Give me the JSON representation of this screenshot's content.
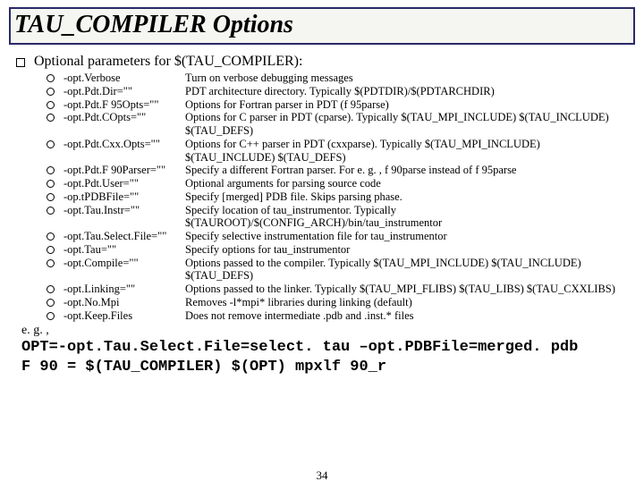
{
  "title": "TAU_COMPILER Options",
  "intro": "Optional parameters for $(TAU_COMPILER):",
  "options": [
    {
      "name": "-opt.Verbose",
      "desc": "Turn on verbose debugging messages"
    },
    {
      "name": "-opt.Pdt.Dir=\"\"",
      "desc": "PDT architecture directory. Typically $(PDTDIR)/$(PDTARCHDIR)"
    },
    {
      "name": "-opt.Pdt.F 95Opts=\"\"",
      "desc": "Options for Fortran parser in PDT (f 95parse)"
    },
    {
      "name": "-opt.Pdt.COpts=\"\"",
      "desc": "Options for C parser in PDT (cparse). Typically $(TAU_MPI_INCLUDE) $(TAU_INCLUDE) $(TAU_DEFS)"
    },
    {
      "name": "-opt.Pdt.Cxx.Opts=\"\"",
      "desc": "Options for C++ parser in PDT (cxxparse). Typically $(TAU_MPI_INCLUDE) $(TAU_INCLUDE) $(TAU_DEFS)"
    },
    {
      "name": "-opt.Pdt.F 90Parser=\"\"",
      "desc": "Specify a different Fortran parser. For e. g. , f 90parse instead of f 95parse"
    },
    {
      "name": "-opt.Pdt.User=\"\"",
      "desc": "Optional arguments for parsing source code"
    },
    {
      "name": "-op.tPDBFile=\"\"",
      "desc": "Specify [merged] PDB file. Skips parsing phase."
    },
    {
      "name": "-opt.Tau.Instr=\"\"",
      "desc": "Specify location of tau_instrumentor. Typically $(TAUROOT)/$(CONFIG_ARCH)/bin/tau_instrumentor"
    },
    {
      "name": "-opt.Tau.Select.File=\"\"",
      "desc": "Specify selective instrumentation file for tau_instrumentor"
    },
    {
      "name": "-opt.Tau=\"\"",
      "desc": "Specify options for tau_instrumentor"
    },
    {
      "name": "-opt.Compile=\"\"",
      "desc": "Options passed to the compiler. Typically $(TAU_MPI_INCLUDE) $(TAU_INCLUDE) $(TAU_DEFS)"
    },
    {
      "name": "-opt.Linking=\"\"",
      "desc": "Options passed to the linker. Typically $(TAU_MPI_FLIBS) $(TAU_LIBS) $(TAU_CXXLIBS)"
    },
    {
      "name": "-opt.No.Mpi",
      "desc": "Removes -l*mpi* libraries during linking (default)"
    },
    {
      "name": "-opt.Keep.Files",
      "desc": "Does not remove intermediate .pdb and .inst.* files"
    }
  ],
  "example_intro": "e. g. ,",
  "example_line1": "OPT=-opt.Tau.Select.File=select. tau –opt.PDBFile=merged. pdb",
  "example_line2": "F 90 = $(TAU_COMPILER) $(OPT) mpxlf 90_r",
  "page": "34"
}
